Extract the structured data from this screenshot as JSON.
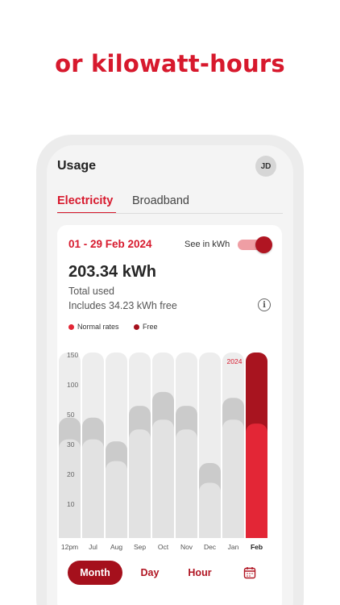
{
  "headline": "or kilowatt-hours",
  "app": {
    "title": "Usage",
    "avatar_initials": "JD"
  },
  "tabs": [
    {
      "label": "Electricity",
      "active": true
    },
    {
      "label": "Broadband",
      "active": false
    }
  ],
  "summary": {
    "date_range": "01 - 29 Feb 2024",
    "toggle_label": "See in kWh",
    "toggle_on": true,
    "total": "203.34 kWh",
    "total_label": "Total used",
    "includes": "Includes 34.23 kWh free"
  },
  "legend": [
    {
      "label": "Normal rates",
      "color": "#e32636"
    },
    {
      "label": "Free",
      "color": "#a5101c"
    }
  ],
  "chart_data": {
    "type": "bar",
    "stacked": true,
    "categories": [
      "12pm",
      "Jul",
      "Aug",
      "Sep",
      "Oct",
      "Nov",
      "Dec",
      "Jan",
      "Feb"
    ],
    "series": [
      {
        "name": "Normal rates",
        "values": [
          50,
          50,
          39,
          55,
          60,
          55,
          28,
          60,
          58
        ]
      },
      {
        "name": "Free",
        "values": [
          11,
          11,
          10,
          12,
          14,
          12,
          10,
          11,
          36
        ]
      }
    ],
    "y_ticks": [
      150,
      100,
      50,
      30,
      20,
      10
    ],
    "year_annotation": "2024",
    "highlight_category": "Feb",
    "colors": {
      "normal": "#e2e2e2",
      "free": "#cbcbcb",
      "highlight_normal": "#e32636",
      "highlight_free": "#a8141f",
      "column_bg": "#ededed"
    }
  },
  "period_selector": [
    {
      "label": "Month",
      "active": true
    },
    {
      "label": "Day",
      "active": false
    },
    {
      "label": "Hour",
      "active": false
    }
  ],
  "calendar_icon": "calendar-icon"
}
